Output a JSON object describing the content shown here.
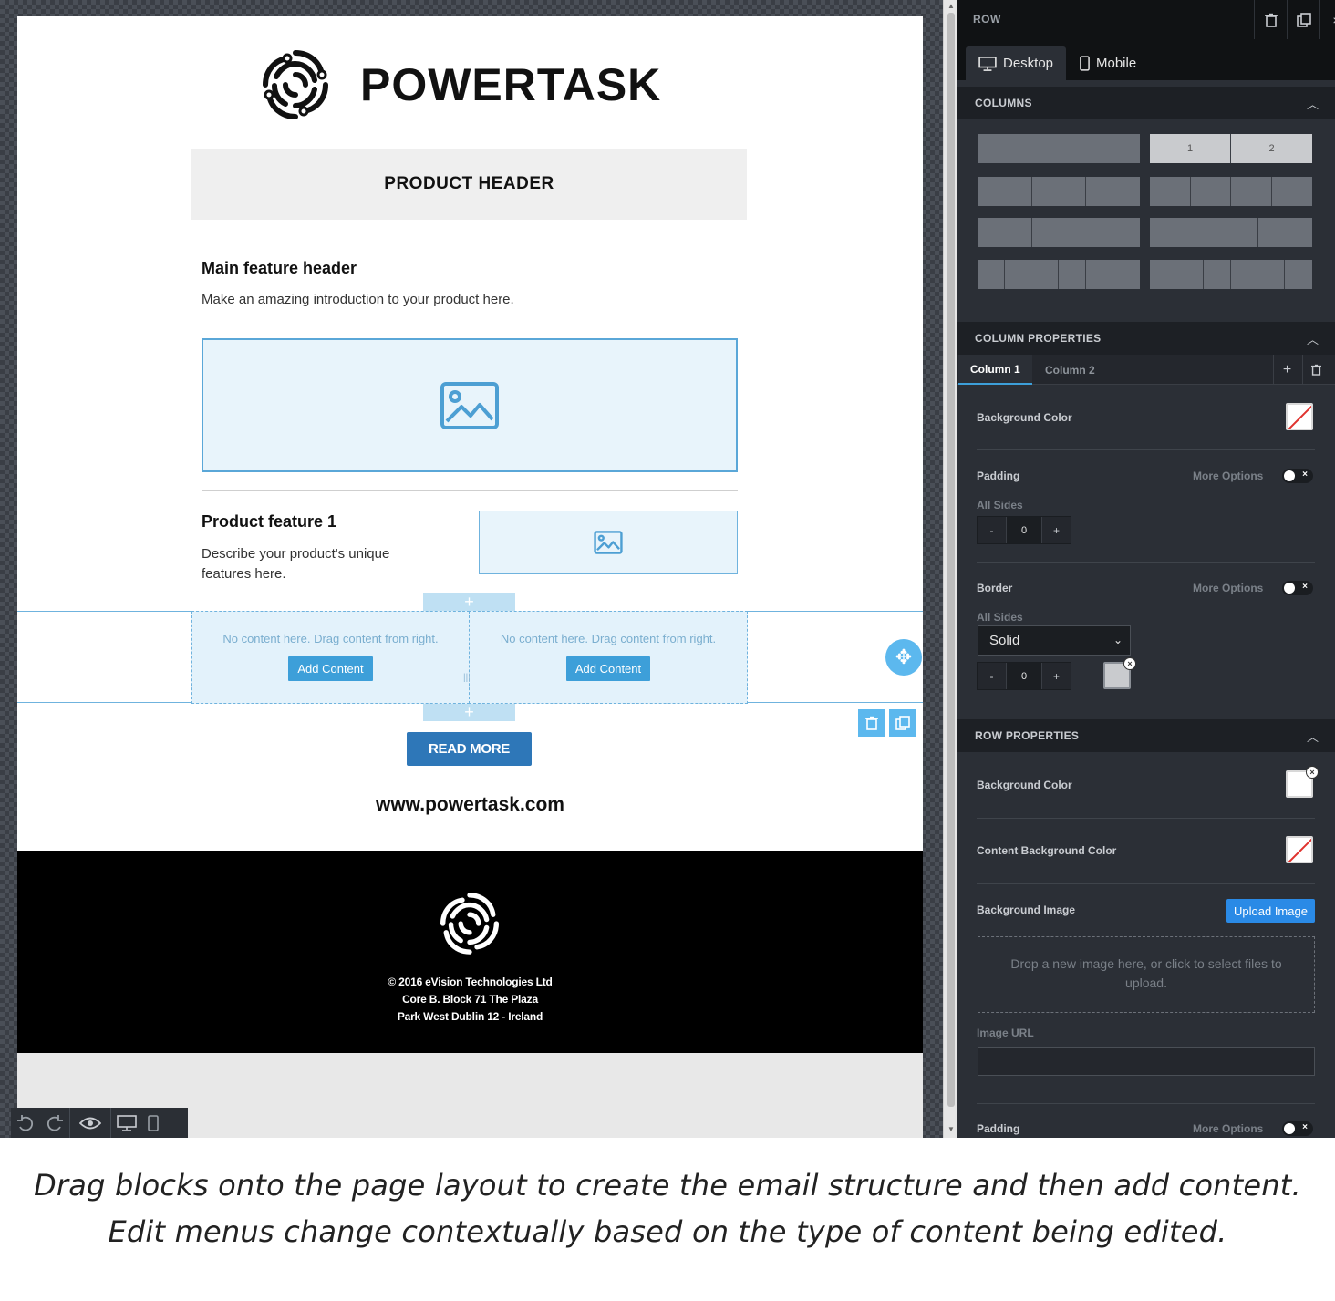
{
  "email": {
    "brand": "POWERTASK",
    "product_header": "PRODUCT HEADER",
    "main_feature_header": "Main feature header",
    "main_feature_desc": "Make an amazing introduction to your product here.",
    "product_feature_title": "Product feature 1",
    "product_feature_desc": "Describe your product's unique features here.",
    "empty_col_msg": "No content here. Drag content from right.",
    "add_content_label": "Add Content",
    "read_more_label": "READ MORE",
    "website": "www.powertask.com",
    "footer_lines": [
      "© 2016 eVision Technologies Ltd",
      "Core B. Block 71 The Plaza",
      "Park West Dublin 12 - Ireland"
    ]
  },
  "panel": {
    "title": "ROW",
    "device_tabs": [
      "Desktop",
      "Mobile"
    ],
    "columns_section": "COLUMNS",
    "layout_selected_labels": [
      "1",
      "2"
    ],
    "column_properties_section": "COLUMN PROPERTIES",
    "column_tabs": [
      "Column 1",
      "Column 2"
    ],
    "background_color_label": "Background Color",
    "padding_label": "Padding",
    "more_options_label": "More Options",
    "all_sides_label": "All Sides",
    "padding_value": "0",
    "border_label": "Border",
    "border_style": "Solid",
    "border_value": "0",
    "row_properties_section": "ROW PROPERTIES",
    "row_background_color_label": "Background Color",
    "content_background_color_label": "Content Background Color",
    "background_image_label": "Background Image",
    "upload_image_label": "Upload Image",
    "dropzone_text": "Drop a new image here, or click to select files to upload.",
    "image_url_label": "Image URL",
    "row_padding_label": "Padding",
    "stepper_minus": "-",
    "stepper_plus": "+"
  },
  "caption": {
    "line1": "Drag blocks onto the page layout to create the email structure and then add content.",
    "line2": "Edit menus change contextually based on the type of content being edited."
  },
  "colors": {
    "accent": "#3d9fd9",
    "read_more": "#2e77b8",
    "panel_bg": "#2b2f36",
    "footer_bg": "#000000"
  }
}
